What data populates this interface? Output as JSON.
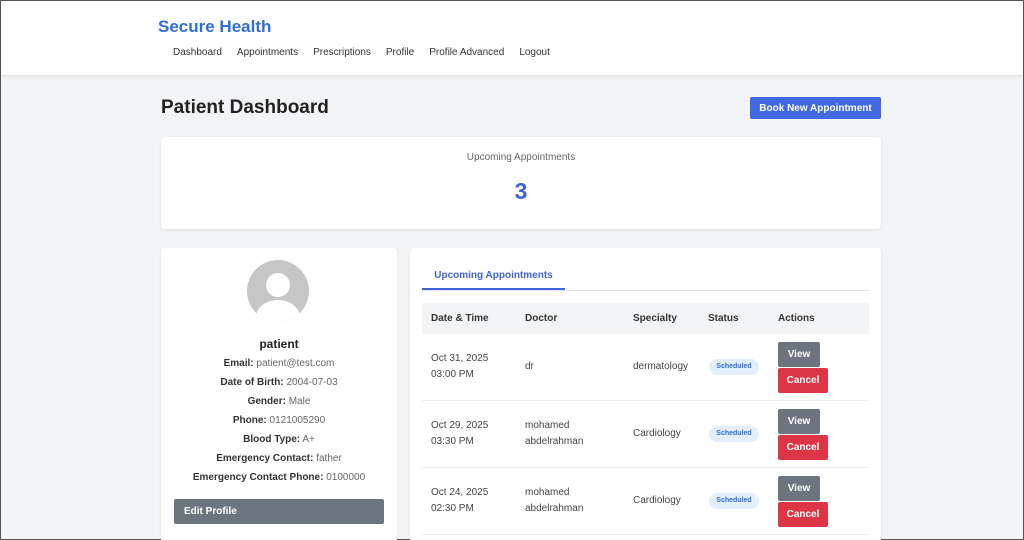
{
  "brand": "Secure Health",
  "nav": [
    "Dashboard",
    "Appointments",
    "Prescriptions",
    "Profile",
    "Profile Advanced",
    "Logout"
  ],
  "page_title": "Patient Dashboard",
  "book_button": "Book New Appointment",
  "stat": {
    "label": "Upcoming Appointments",
    "value": "3"
  },
  "profile": {
    "name": "patient",
    "fields": [
      {
        "label": "Email:",
        "value": "patient@test.com"
      },
      {
        "label": "Date of Birth:",
        "value": "2004-07-03"
      },
      {
        "label": "Gender:",
        "value": "Male"
      },
      {
        "label": "Phone:",
        "value": "0121005290"
      },
      {
        "label": "Blood Type:",
        "value": "A+"
      },
      {
        "label": "Emergency Contact:",
        "value": "father"
      },
      {
        "label": "Emergency Contact Phone:",
        "value": "0100000"
      }
    ],
    "edit_button": "Edit Profile"
  },
  "appointments": {
    "tab": "Upcoming Appointments",
    "columns": [
      "Date & Time",
      "Doctor",
      "Specialty",
      "Status",
      "Actions"
    ],
    "view_label": "View",
    "cancel_label": "Cancel",
    "rows": [
      {
        "date": "Oct 31, 2025",
        "time": "03:00 PM",
        "doctor_line1": "dr",
        "doctor_line2": "",
        "specialty": "dermatology",
        "status": "Scheduled"
      },
      {
        "date": "Oct 29, 2025",
        "time": "03:30 PM",
        "doctor_line1": "mohamed",
        "doctor_line2": "abdelrahman",
        "specialty": "Cardiology",
        "status": "Scheduled"
      },
      {
        "date": "Oct 24, 2025",
        "time": "02:30 PM",
        "doctor_line1": "mohamed",
        "doctor_line2": "abdelrahman",
        "specialty": "Cardiology",
        "status": "Scheduled"
      }
    ]
  },
  "colors": {
    "brand": "#2f6fd6",
    "primary": "#4169e1",
    "danger": "#dc3545",
    "secondary": "#6c757d",
    "background": "#f3f4f6"
  }
}
